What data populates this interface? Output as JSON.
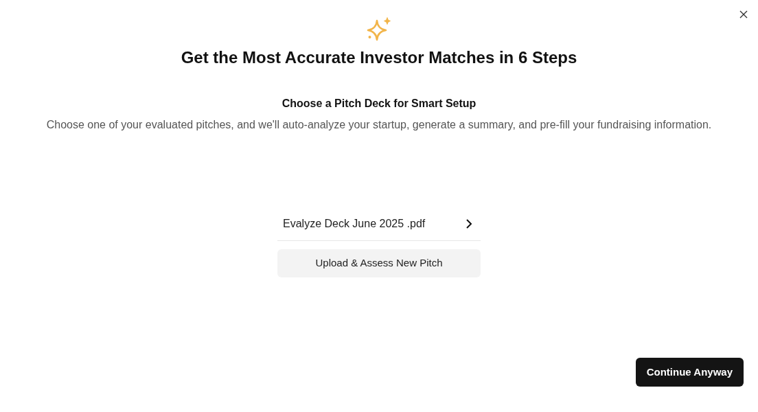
{
  "title": "Get the Most Accurate Investor Matches in 6 Steps",
  "subtitle": "Choose a Pitch Deck for Smart Setup",
  "description": "Choose one of your evaluated pitches, and we'll auto-analyze your startup, generate a summary, and pre-fill your fundraising information.",
  "decks": [
    {
      "name": "Evalyze Deck June 2025 .pdf"
    }
  ],
  "upload_button": "Upload & Assess New Pitch",
  "continue_button": "Continue Anyway"
}
